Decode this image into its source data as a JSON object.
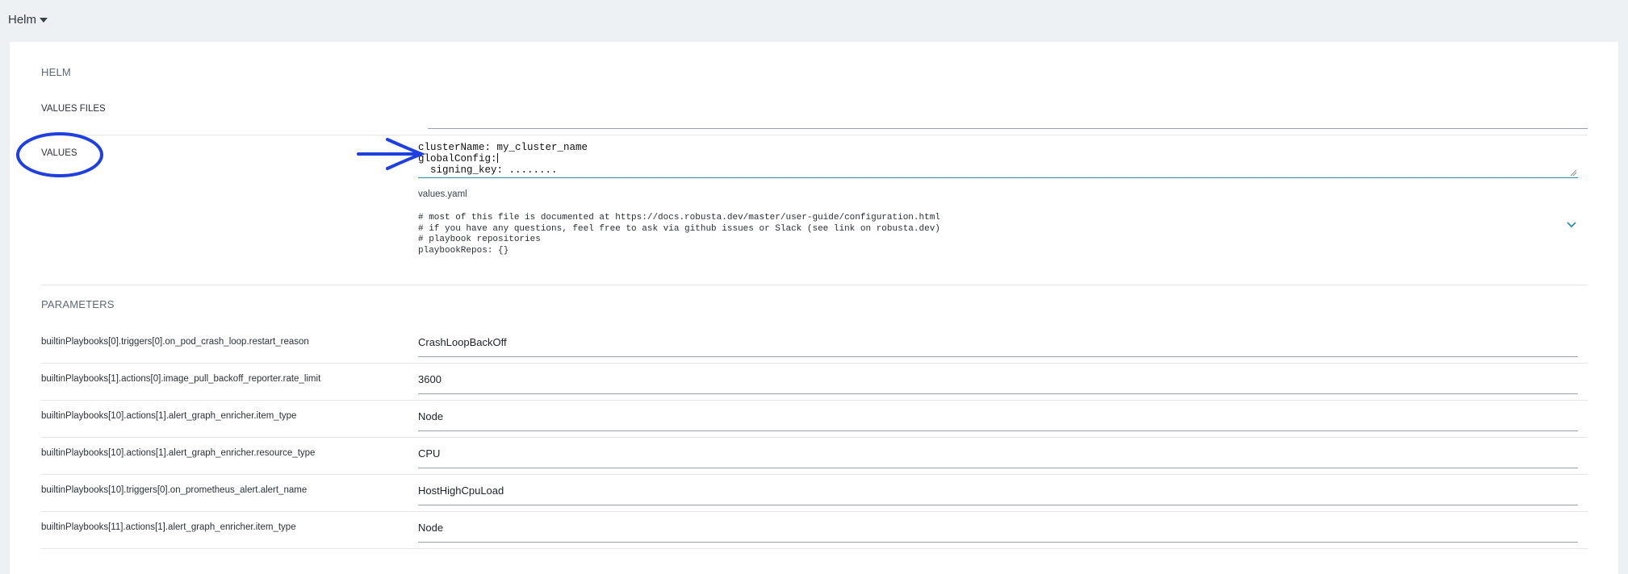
{
  "topbar": {
    "title": "Helm"
  },
  "helm": {
    "section_title": "HELM",
    "values_files_label": "VALUES FILES",
    "values_label": "VALUES",
    "values_lines": [
      "clusterName: my_cluster_name",
      "globalConfig:",
      "  signing_key: ........"
    ],
    "values_yaml_title": "values.yaml",
    "yaml_lines": [
      "# most of this file is documented at https://docs.robusta.dev/master/user-guide/configuration.html",
      "# if you have any questions, feel free to ask via github issues or Slack (see link on robusta.dev)",
      "",
      "# playbook repositories",
      "playbookRepos: {}"
    ]
  },
  "parameters": {
    "section_title": "PARAMETERS",
    "rows": [
      {
        "name": "builtinPlaybooks[0].triggers[0].on_pod_crash_loop.restart_reason",
        "value": "CrashLoopBackOff"
      },
      {
        "name": "builtinPlaybooks[1].actions[0].image_pull_backoff_reporter.rate_limit",
        "value": "3600"
      },
      {
        "name": "builtinPlaybooks[10].actions[1].alert_graph_enricher.item_type",
        "value": "Node"
      },
      {
        "name": "builtinPlaybooks[10].actions[1].alert_graph_enricher.resource_type",
        "value": "CPU"
      },
      {
        "name": "builtinPlaybooks[10].triggers[0].on_prometheus_alert.alert_name",
        "value": "HostHighCpuLoad"
      },
      {
        "name": "builtinPlaybooks[11].actions[1].alert_graph_enricher.item_type",
        "value": "Node"
      }
    ]
  },
  "colors": {
    "annotation": "#1f3fdf",
    "accent": "#2f8fb1",
    "background": "#eef1f4"
  },
  "icons": [
    "caret-down-icon",
    "chevron-down-icon",
    "resize-handle-icon"
  ]
}
